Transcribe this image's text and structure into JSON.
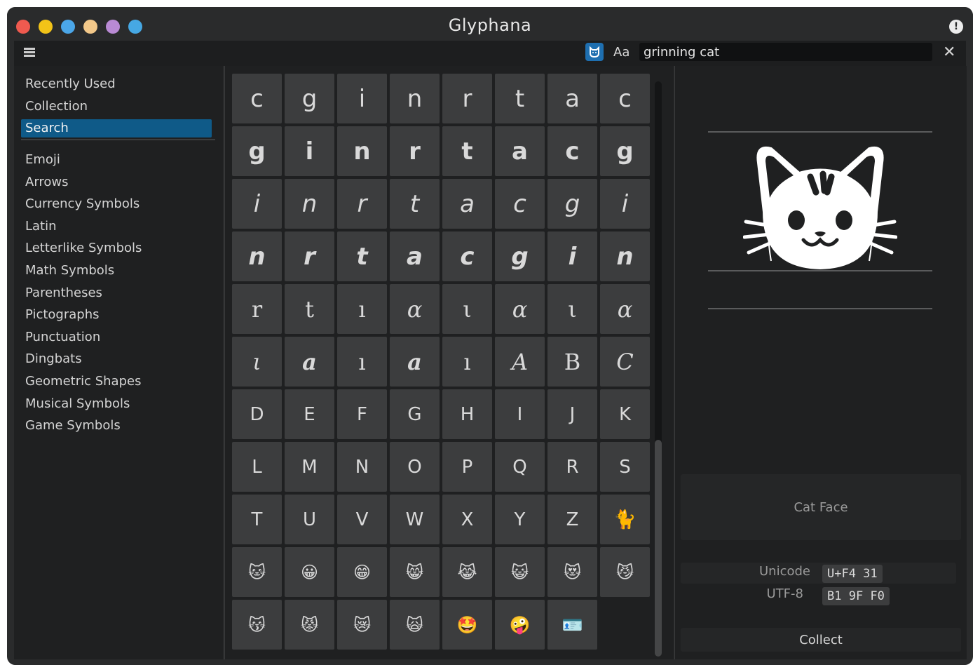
{
  "app": {
    "title": "Glyphana",
    "window_dots": [
      "#ef5a4f",
      "#f2c318",
      "#4ba6e8",
      "#f3c88a",
      "#b98ad4",
      "#46a8e4"
    ],
    "info_label": "!"
  },
  "toolbar": {
    "search_value": "grinning cat",
    "aa_label": "Aa",
    "clear_label": "✕"
  },
  "sidebar": {
    "top_items": [
      {
        "label": "Recently Used",
        "active": false
      },
      {
        "label": "Collection",
        "active": false
      },
      {
        "label": "Search",
        "active": true
      }
    ],
    "categories": [
      "Emoji",
      "Arrows",
      "Currency Symbols",
      "Latin",
      "Letterlike Symbols",
      "Math Symbols",
      "Parentheses",
      "Pictographs",
      "Punctuation",
      "Dingbats",
      "Geometric Shapes",
      "Musical Symbols",
      "Game Symbols"
    ]
  },
  "glyphs": [
    [
      "c",
      "g",
      "i",
      "n",
      "r",
      "t",
      "a",
      "c"
    ],
    [
      "g",
      "i",
      "n",
      "r",
      "t",
      "a",
      "c",
      "g"
    ],
    [
      "i",
      "n",
      "r",
      "t",
      "a",
      "c",
      "g",
      "i"
    ],
    [
      "n",
      "r",
      "t",
      "a",
      "c",
      "g",
      "i",
      "n"
    ],
    [
      "r",
      "t",
      "ı",
      "α",
      "ι",
      "α",
      "ι",
      "α"
    ],
    [
      "ι",
      "a",
      "ı",
      "a",
      "ı",
      "A",
      "B",
      "C"
    ],
    [
      "D",
      "E",
      "F",
      "G",
      "H",
      "I",
      "J",
      "K"
    ],
    [
      "L",
      "M",
      "N",
      "O",
      "P",
      "Q",
      "R",
      "S"
    ],
    [
      "T",
      "U",
      "V",
      "W",
      "X",
      "Y",
      "Z",
      "🐈"
    ],
    [
      "🐱",
      "😀",
      "😁",
      "😸",
      "😹",
      "😺",
      "😻",
      "😼"
    ],
    [
      "😽",
      "😾",
      "😿",
      "🙀",
      "🤩",
      "🤪",
      "🪪"
    ]
  ],
  "detail": {
    "glyph": "🐱",
    "name": "Cat Face",
    "unicode_label": "Unicode",
    "unicode_value": "U+F4 31",
    "utf8_label": "UTF-8",
    "utf8_value": "B1 9F F0",
    "collect_label": "Collect"
  }
}
